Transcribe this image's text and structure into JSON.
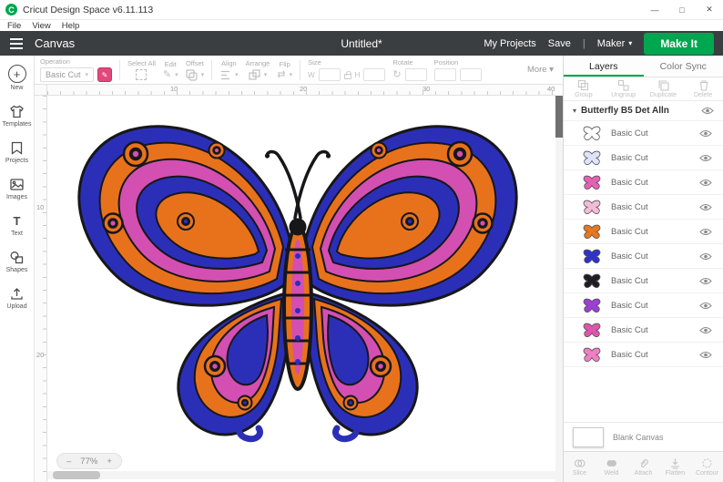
{
  "palette": {
    "green": "#00a650",
    "blue": "#2b2fb8",
    "orange": "#e8721c",
    "magenta": "#d44fb2",
    "black": "#17171a",
    "header_bg": "#3b3e41",
    "swatch": "#e2487c"
  },
  "titlebar": {
    "logo_letter": "C",
    "app_title": "Cricut Design Space  v6.11.113",
    "minimize_glyph": "—",
    "maximize_glyph": "□",
    "close_glyph": "✕"
  },
  "menubar": {
    "items": [
      "File",
      "View",
      "Help"
    ]
  },
  "header": {
    "canvas_label": "Canvas",
    "doc_title": "Untitled*",
    "my_projects": "My Projects",
    "save": "Save",
    "divider": "|",
    "machine": "Maker",
    "chevron": "▾",
    "make_it": "Make It"
  },
  "sidebar": {
    "plus_glyph": "+",
    "items": [
      {
        "label": "New"
      },
      {
        "label": "Templates"
      },
      {
        "label": "Projects"
      },
      {
        "label": "Images"
      },
      {
        "label": "Text"
      },
      {
        "label": "Shapes"
      },
      {
        "label": "Upload"
      }
    ]
  },
  "toolbar": {
    "operation_label": "Operation",
    "operation_value": "Basic Cut",
    "select_all_label": "Select All",
    "edit_label": "Edit",
    "offset_label": "Offset",
    "align_label": "Align",
    "arrange_label": "Arrange",
    "flip_label": "Flip",
    "size_label": "Size",
    "w_label": "W",
    "h_label": "H",
    "rotate_label": "Rotate",
    "position_label": "Position",
    "more_label": "More ▾",
    "chevron": "▾",
    "pencil_glyph": "✎",
    "flip_glyph": "⇄",
    "rotate_glyph": "↻"
  },
  "rulers": {
    "h": [
      "10",
      "20",
      "30",
      "40"
    ],
    "v": [
      "10",
      "20"
    ]
  },
  "canvas": {
    "zoom_out": "–",
    "zoom_value": "77%",
    "zoom_in": "+"
  },
  "layers_panel": {
    "tabs": [
      "Layers",
      "Color Sync"
    ],
    "actions": [
      "Group",
      "Ungroup",
      "Duplicate",
      "Delete"
    ],
    "group_chevron": "▾",
    "group_title": "Butterfly B5 Det Alln",
    "layers": [
      {
        "label": "Basic Cut",
        "color": "#ffffff"
      },
      {
        "label": "Basic Cut",
        "color": "#dfe3fb"
      },
      {
        "label": "Basic Cut",
        "color": "#e561b5"
      },
      {
        "label": "Basic Cut",
        "color": "#f3bcd6"
      },
      {
        "label": "Basic Cut",
        "color": "#e8771f"
      },
      {
        "label": "Basic Cut",
        "color": "#2f33c9"
      },
      {
        "label": "Basic Cut",
        "color": "#1f1f23"
      },
      {
        "label": "Basic Cut",
        "color": "#9c3fd4"
      },
      {
        "label": "Basic Cut",
        "color": "#df55ad"
      },
      {
        "label": "Basic Cut",
        "color": "#f07ec4"
      }
    ],
    "blank_canvas_label": "Blank Canvas",
    "bottom_actions": [
      "Slice",
      "Weld",
      "Attach",
      "Flatten",
      "Contour"
    ]
  }
}
